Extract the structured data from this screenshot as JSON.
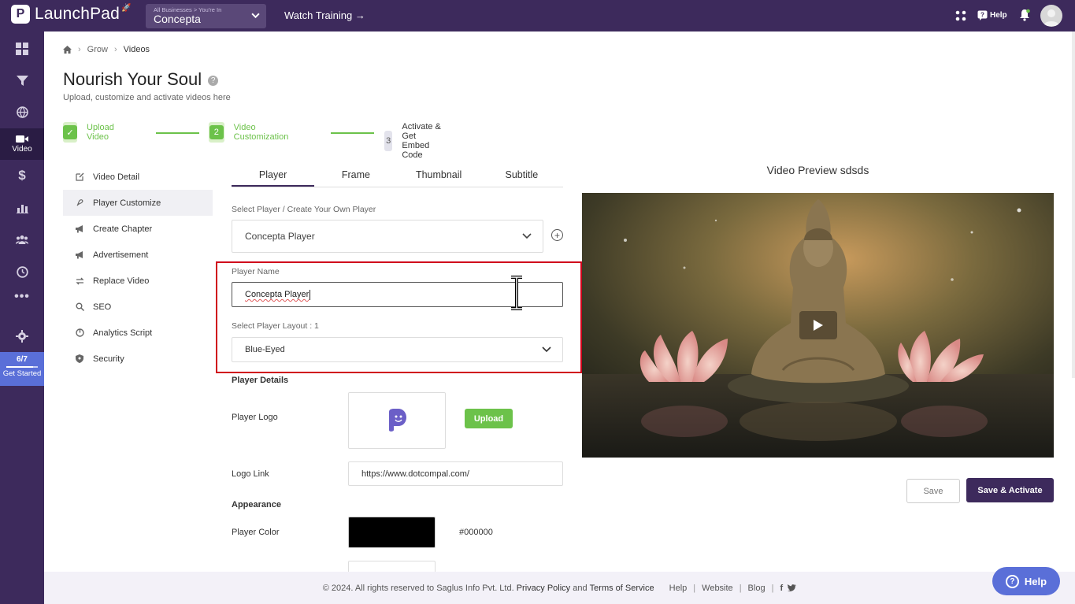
{
  "app": {
    "name": "LaunchPad"
  },
  "business": {
    "path": "All Businesses > You're In",
    "name": "Concepta"
  },
  "topbar": {
    "watch_training": "Watch Training →",
    "help": "Help"
  },
  "sidebar": {
    "active_label": "Video",
    "progress": {
      "count": "6/7",
      "fraction": 0.857,
      "label": "Get Started"
    }
  },
  "breadcrumb": [
    "Grow",
    "Videos"
  ],
  "page": {
    "title": "Nourish Your Soul",
    "subtitle": "Upload, customize and activate videos here"
  },
  "steps": [
    {
      "label": "Upload Video",
      "state": "done"
    },
    {
      "label": "Video Customization",
      "number": "2",
      "state": "current"
    },
    {
      "label": "Activate & Get Embed Code",
      "number": "3",
      "state": "pending"
    }
  ],
  "leftnav": [
    {
      "label": "Video Detail",
      "icon": "edit-icon"
    },
    {
      "label": "Player Customize",
      "icon": "palette-icon",
      "active": true
    },
    {
      "label": "Create Chapter",
      "icon": "megaphone-icon"
    },
    {
      "label": "Advertisement",
      "icon": "megaphone-icon"
    },
    {
      "label": "Replace Video",
      "icon": "swap-icon"
    },
    {
      "label": "SEO",
      "icon": "search-icon"
    },
    {
      "label": "Analytics Script",
      "icon": "analytics-icon"
    },
    {
      "label": "Security",
      "icon": "shield-icon"
    }
  ],
  "tabs": [
    "Player",
    "Frame",
    "Thumbnail",
    "Subtitle"
  ],
  "form": {
    "select_player_label": "Select Player / Create Your Own Player",
    "select_player_value": "Concepta Player",
    "player_name_label": "Player Name",
    "player_name_value": "Concepta Player",
    "layout_label": "Select Player Layout : 1",
    "layout_value": "Blue-Eyed",
    "player_details": "Player Details",
    "player_logo": "Player Logo",
    "upload": "Upload",
    "logo_link_label": "Logo Link",
    "logo_link_value": "https://www.dotcompal.com/",
    "appearance": "Appearance",
    "player_color_label": "Player Color",
    "player_color_value": "#000000"
  },
  "preview": {
    "title": "Video Preview sdsds"
  },
  "actions": {
    "save": "Save",
    "save_activate": "Save & Activate"
  },
  "footer": {
    "copyright": "©  2024. All rights reserved to Saglus Info Pvt. Ltd.",
    "privacy": "Privacy Policy",
    "and": "and",
    "terms": "Terms of Service",
    "help": "Help",
    "website": "Website",
    "blog": "Blog"
  },
  "help_fab": "Help",
  "colors": {
    "brand": "#3d2a5c",
    "success": "#6cc24a",
    "accent": "#5a6fd8",
    "highlight": "#d0021b"
  }
}
